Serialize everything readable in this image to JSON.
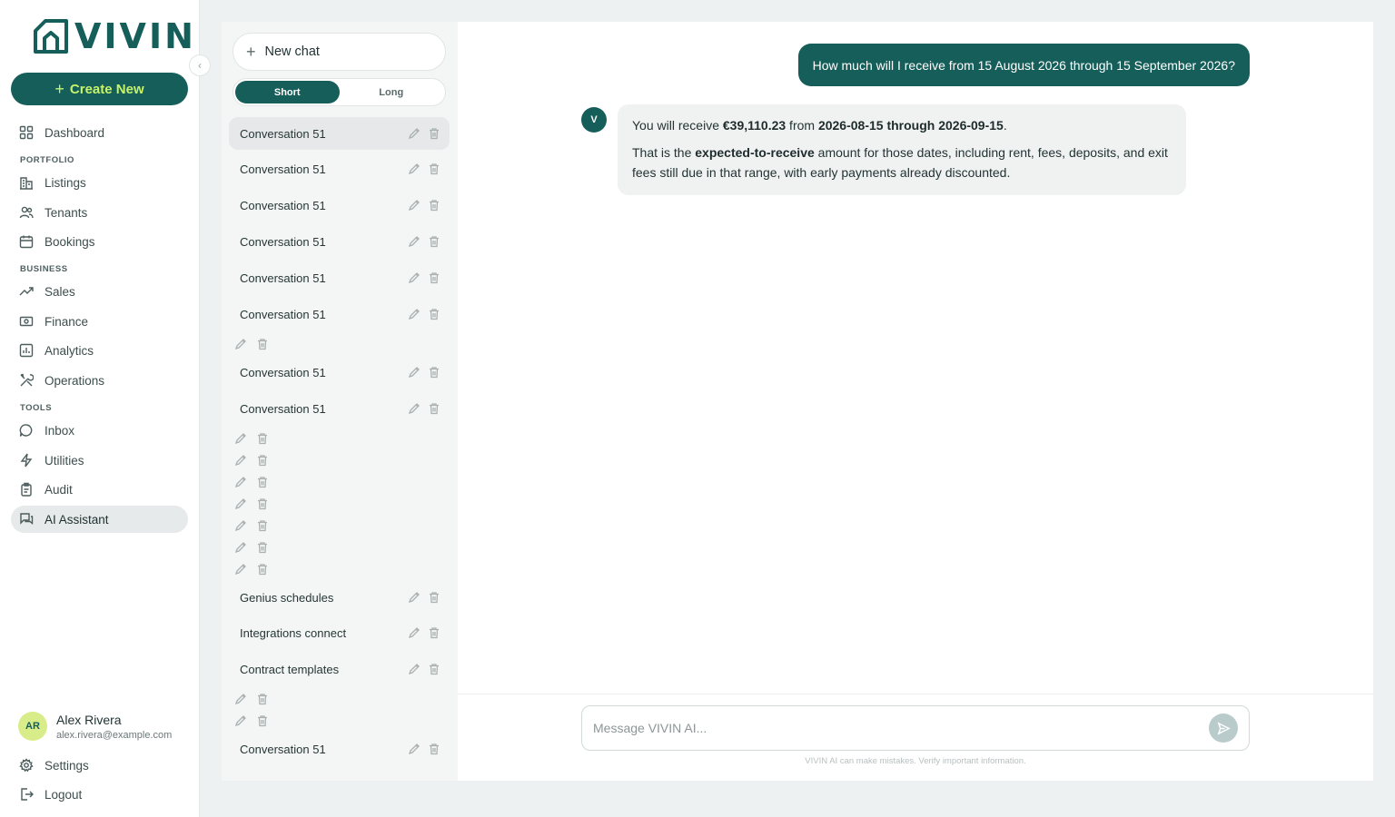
{
  "app": {
    "logo_text": "VIVIN"
  },
  "sidebar": {
    "create_label": "Create New",
    "sections": {
      "portfolio": "PORTFOLIO",
      "business": "BUSINESS",
      "tools": "TOOLS"
    },
    "items": {
      "dashboard": "Dashboard",
      "listings": "Listings",
      "tenants": "Tenants",
      "bookings": "Bookings",
      "sales": "Sales",
      "finance": "Finance",
      "analytics": "Analytics",
      "operations": "Operations",
      "inbox": "Inbox",
      "utilities": "Utilities",
      "audit": "Audit",
      "ai_assistant": "AI Assistant"
    },
    "user": {
      "initials": "AR",
      "name": "Alex Rivera",
      "email": "alex.rivera@example.com"
    },
    "settings_label": "Settings",
    "logout_label": "Logout"
  },
  "conversations": {
    "new_chat_label": "New chat",
    "modes": {
      "short": "Short",
      "long": "Long",
      "active": "Short"
    },
    "list": [
      "Conversation 51",
      "Conversation 51",
      "Conversation 51",
      "Conversation 51",
      "Conversation 51",
      "Conversation 51",
      "Conversation 51",
      "Conversation 51",
      "Genius schedules",
      "Integrations connect",
      "Contract templates",
      "Conversation 51"
    ]
  },
  "chat": {
    "user_message": "How much will I receive from 15 August 2026 through 15 September 2026?",
    "ai_avatar": "V",
    "ai_reply": {
      "p1_a": "You will receive ",
      "p1_amount": "€39,110.23",
      "p1_b": " from ",
      "p1_range": "2026-08-15 through 2026-09-15",
      "p1_c": ".",
      "p2_a": "That is the ",
      "p2_term": "expected-to-receive",
      "p2_b": " amount for those dates, including rent, fees, deposits, and exit fees still due in that range, with early payments already discounted."
    },
    "input_placeholder": "Message VIVIN AI...",
    "disclaimer": "VIVIN AI can make mistakes. Verify important information."
  },
  "colors": {
    "brand": "#155e5a",
    "accent": "#c6f36a",
    "avatar_bg": "#d9ec8a"
  }
}
